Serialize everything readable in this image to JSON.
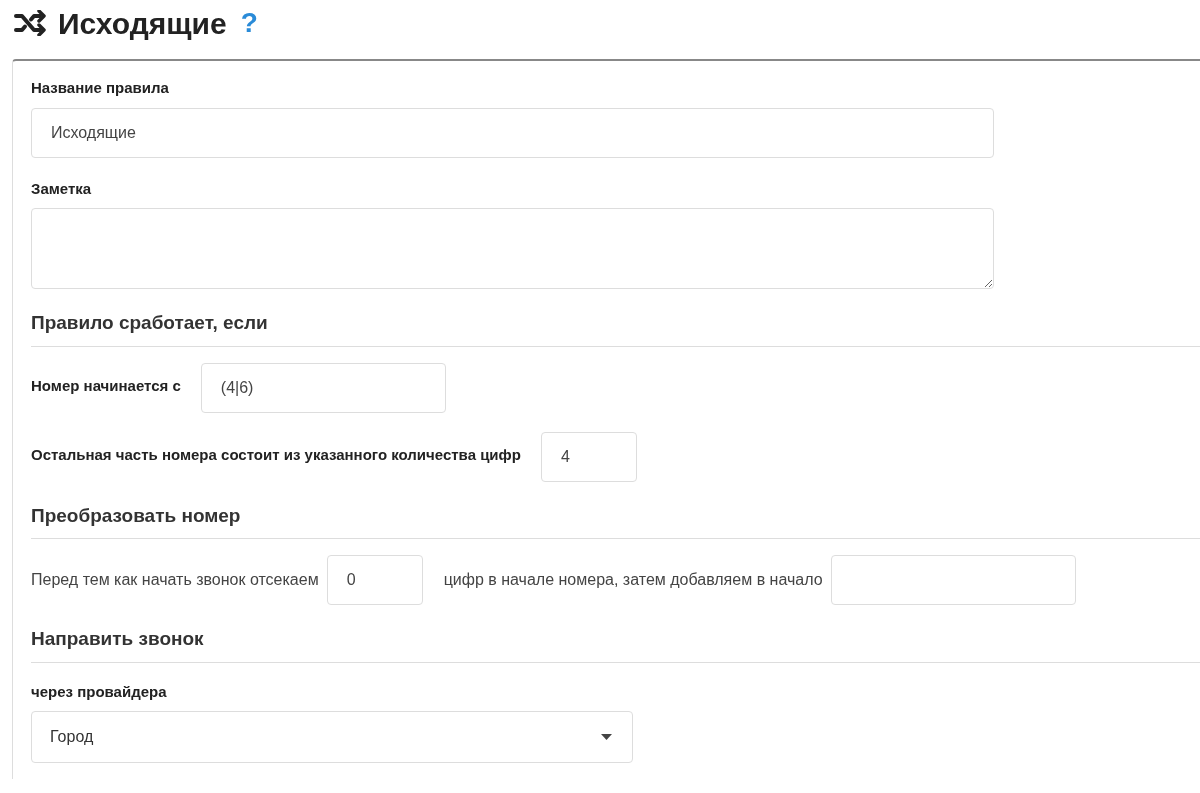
{
  "header": {
    "title": "Исходящие",
    "help": "?"
  },
  "rule_name": {
    "label": "Название правила",
    "value": "Исходящие"
  },
  "note": {
    "label": "Заметка"
  },
  "condition": {
    "heading": "Правило сработает, если",
    "fields": [
      {
        "label": "Номер начинается с",
        "value": "(4|6)"
      },
      {
        "label": "Остальная часть номера состоит из указанного количества цифр",
        "value": "4"
      }
    ]
  },
  "transform": {
    "heading": "Преобразовать номер",
    "text_before": "Перед тем как начать звонок отсекаем",
    "cut_value": "0",
    "text_after": "цифр в начале номера, затем добавляем в начало"
  },
  "route": {
    "heading": "Направить звонок",
    "label": "через провайдера",
    "selected": "Город"
  }
}
